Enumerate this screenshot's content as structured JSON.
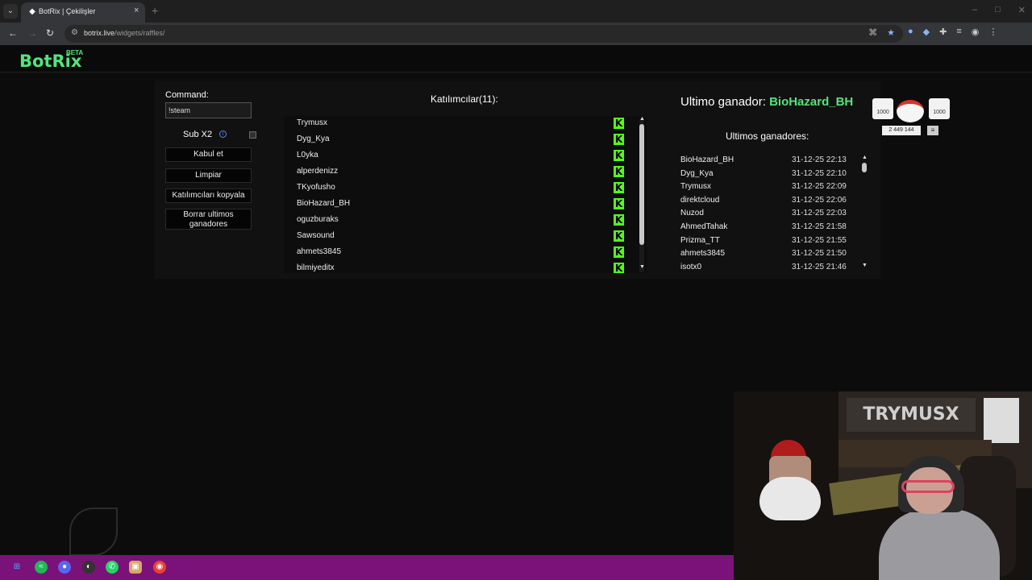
{
  "browser": {
    "tab_title": "BotRix | Çekilişler",
    "tab_close": "×",
    "new_tab": "+",
    "url_host": "botrix.live",
    "url_path": "/widgets/raffles/",
    "menu_glyph": "⌄",
    "back": "←",
    "forward": "→",
    "reload": "↻",
    "controls": [
      "–",
      "□",
      "✕"
    ]
  },
  "app": {
    "logo": "BotRix",
    "logo_badge": "BETA"
  },
  "controls": {
    "command_label": "Command:",
    "command_value": "!steam",
    "sub_label": "Sub X2",
    "info_icon": "i",
    "accept_button": "Kabul et",
    "clear_button": "Limpiar",
    "copy_button": "Katılımcıları kopyala",
    "delete_winners_button": "Borrar ultimos ganadores",
    "sub_checked": false
  },
  "participants": {
    "title": "Katılımcılar(11):",
    "platform_glyph": "K",
    "names": [
      "Trymusx",
      "Dyg_Kya",
      "L0yka",
      "alperdenizz",
      "TKyofusho",
      "BioHazard_BH",
      "oguzburaks",
      "Sawsound",
      "ahmets3845",
      "bilmiyeditx"
    ]
  },
  "winner": {
    "label": "Ultimo ganador:",
    "name": "BioHazard_BH"
  },
  "recent_winners": {
    "title": "Ultimos ganadores:",
    "rows": [
      {
        "name": "BioHazard_BH",
        "date": "31-12-25 22:13"
      },
      {
        "name": "Dyg_Kya",
        "date": "31-12-25 22:10"
      },
      {
        "name": "Trymusx",
        "date": "31-12-25 22:09"
      },
      {
        "name": "direktcloud",
        "date": "31-12-25 22:06"
      },
      {
        "name": "Nuzod",
        "date": "31-12-25 22:03"
      },
      {
        "name": "AhmedTahak",
        "date": "31-12-25 21:58"
      },
      {
        "name": "Prizma_TT",
        "date": "31-12-25 21:55"
      },
      {
        "name": "ahmets3845",
        "date": "31-12-25 21:50"
      },
      {
        "name": "isotx0",
        "date": "31-12-25 21:46"
      }
    ]
  },
  "stream_overlay": {
    "sticker_left": "1000",
    "sticker_right": "1000",
    "sticker_count": "2 449 144",
    "webcam_sign": "TRYMUSX"
  },
  "colors": {
    "accent": "#54e37c",
    "kick_green": "#53fc18",
    "taskbar": "#7a127a"
  }
}
